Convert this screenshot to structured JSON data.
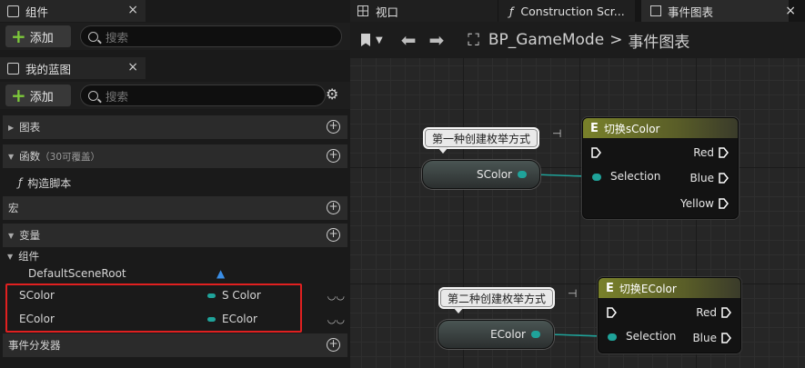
{
  "left": {
    "tab_components": "组件",
    "close": "×",
    "add_label": "添加",
    "search_placeholder": "搜索",
    "tab_blueprint": "我的蓝图",
    "sections": {
      "graphs": "图表",
      "functions": "函数",
      "functions_note": "（30可覆盖）",
      "construct": "构造脚本",
      "macros": "宏",
      "variables": "变量",
      "components_group": "组件",
      "default_root": "DefaultSceneRoot",
      "dispatchers": "事件分发器"
    },
    "variables": [
      {
        "name": "SColor",
        "type": "S Color"
      },
      {
        "name": "EColor",
        "type": "EColor"
      }
    ],
    "highlight_color": "#e02020"
  },
  "right": {
    "tabs": [
      {
        "label": "视口"
      },
      {
        "label": "Construction Scr..."
      },
      {
        "label": "事件图表"
      }
    ],
    "breadcrumb_root": "BP_GameMode",
    "breadcrumb_sep": ">",
    "breadcrumb_current": "事件图表",
    "comment1": "第一种创建枚举方式",
    "comment2": "第二种创建枚举方式",
    "var1": "SColor",
    "var2": "EColor",
    "switch1": {
      "title": "切换sColor",
      "input": "Selection",
      "outputs": [
        "Red",
        "Blue",
        "Yellow"
      ]
    },
    "switch2": {
      "title": "切换EColor",
      "input": "Selection",
      "outputs": [
        "Red",
        "Blue"
      ]
    },
    "enum_color": "#1fa39a"
  }
}
